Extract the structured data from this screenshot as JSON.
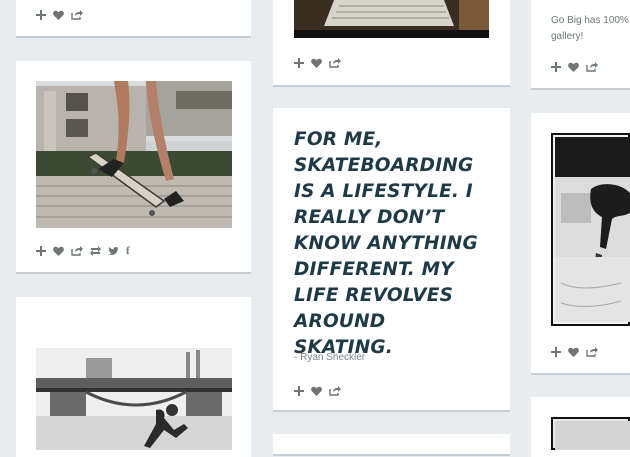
{
  "quote_card": {
    "text": "FOR ME, SKATEBOARDING IS A LIFESTYLE. I REALLY DON’T KNOW ANYTHING DIFFERENT. MY LIFE REVOLVES AROUND SKATING.",
    "attribution": "- Ryan Sheckler"
  },
  "right_top_card": {
    "text": "Go Big has 100% gallery!"
  },
  "icons": {
    "add": "plus-icon",
    "like": "heart-icon",
    "share": "share-icon",
    "reblog": "reblog-icon",
    "twitter": "twitter-icon",
    "facebook": "facebook-icon"
  },
  "social": {
    "facebook_glyph": "f"
  },
  "colors": {
    "background": "#e8ecee",
    "card": "#ffffff",
    "quote_text": "#1f3a47",
    "icon_gray": "#6f7478"
  }
}
